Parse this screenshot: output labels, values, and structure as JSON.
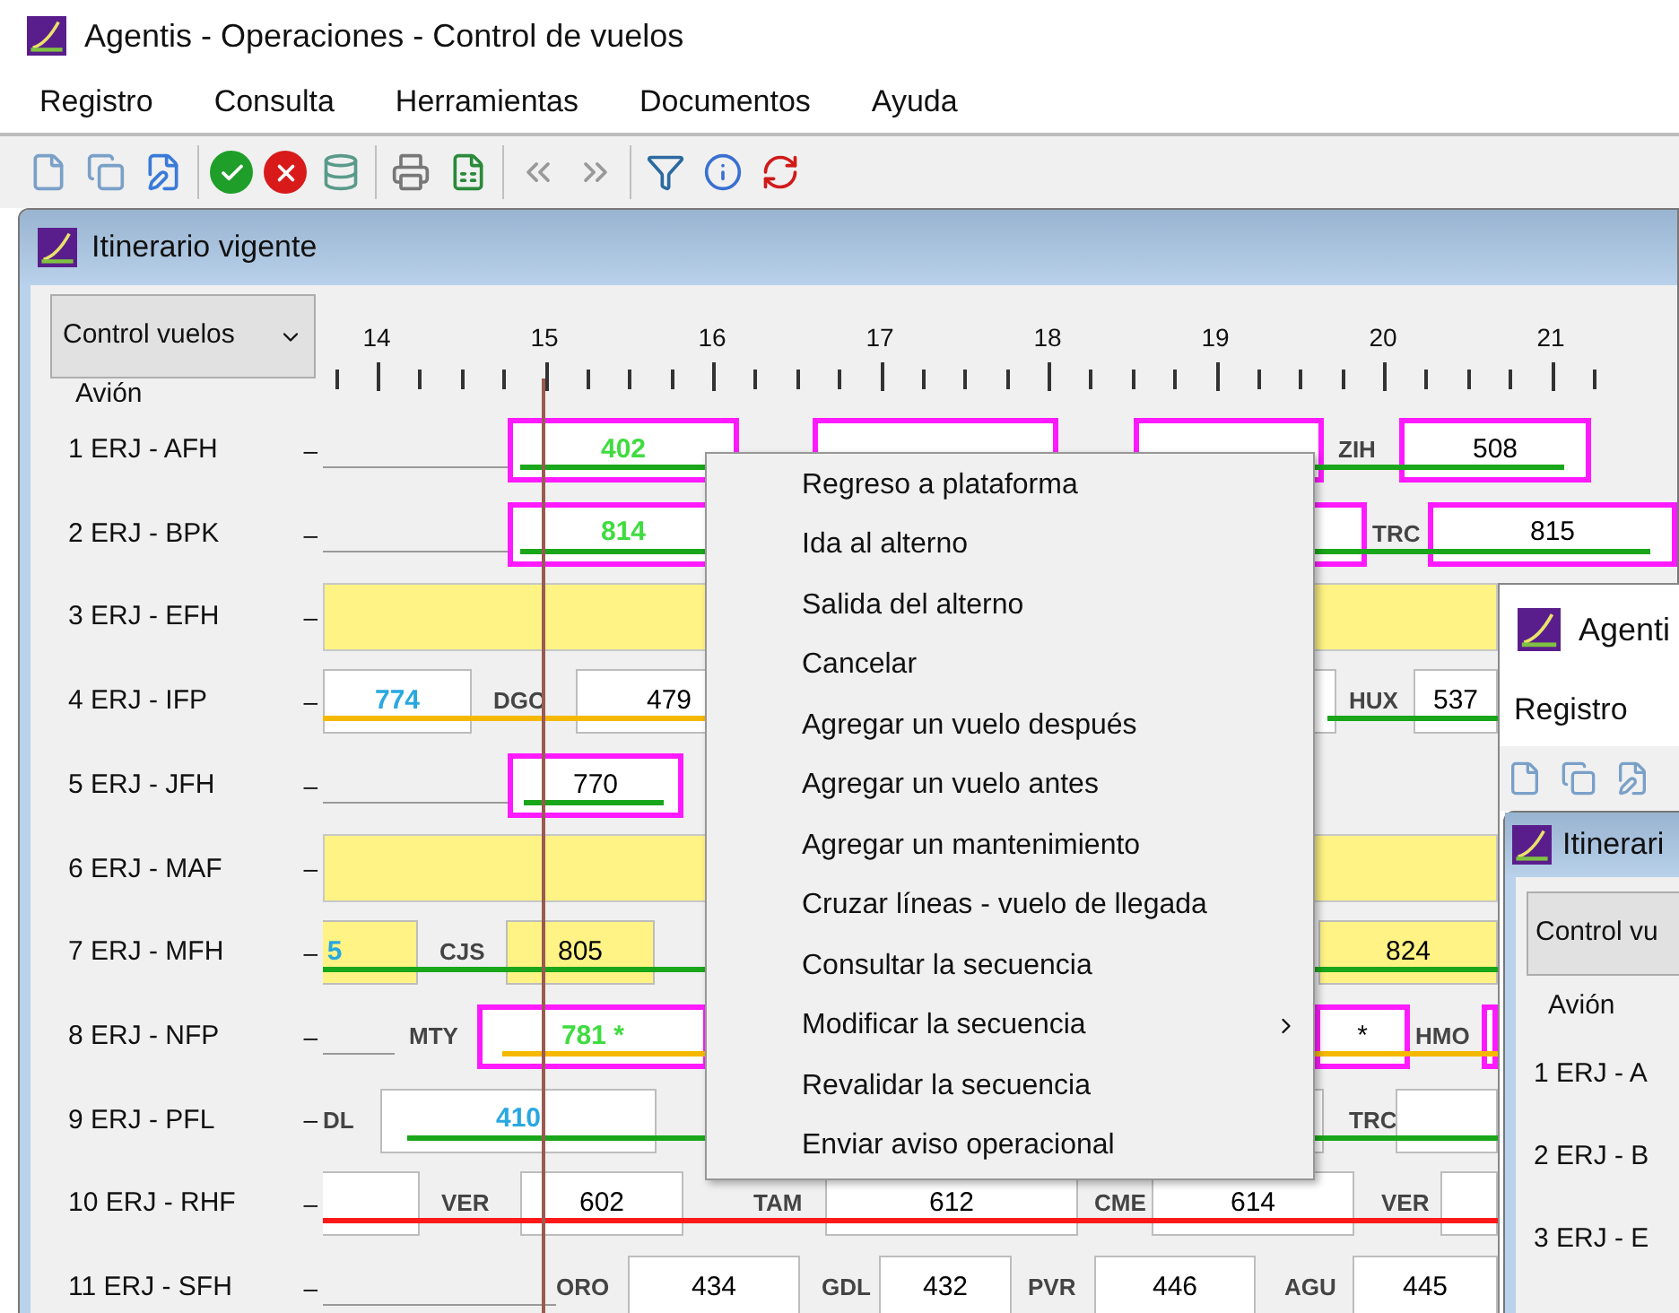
{
  "window": {
    "title": "Agentis - Operaciones - Control de vuelos"
  },
  "menu": [
    "Registro",
    "Consulta",
    "Herramientas",
    "Documentos",
    "Ayuda"
  ],
  "itinerary": {
    "title": "Itinerario vigente",
    "view": "Control vuelos",
    "aircraft_header": "Avión",
    "hours": [
      "14",
      "15",
      "16",
      "17",
      "18",
      "19",
      "20",
      "21"
    ],
    "rows": [
      {
        "aircraft": "1 ERJ - AFH",
        "prefix": "–",
        "tracks": [
          {
            "color": "#1aa61a"
          }
        ],
        "items": [
          {
            "kind": "line"
          },
          {
            "kind": "flight",
            "text": "402",
            "highlighted": true,
            "shaded": false,
            "color": "#3fdc3f"
          },
          {
            "kind": "flight",
            "highlighted": true,
            "shaded": false
          },
          {
            "kind": "flight",
            "highlighted": true,
            "shaded": false
          },
          {
            "kind": "station",
            "text": "ZIH"
          },
          {
            "kind": "flight",
            "text": "508",
            "highlighted": true,
            "shaded": false,
            "color": "#000000"
          }
        ]
      },
      {
        "aircraft": "2 ERJ - BPK",
        "prefix": "–",
        "tracks": [
          {
            "color": "#1aa61a"
          }
        ],
        "items": [
          {
            "kind": "line"
          },
          {
            "kind": "flight",
            "text": "814",
            "highlighted": true,
            "shaded": false,
            "color": "#3fdc3f"
          },
          {
            "kind": "flight",
            "highlighted": true,
            "shaded": false
          },
          {
            "kind": "station",
            "text": "TRC"
          },
          {
            "kind": "flight",
            "text": "815",
            "highlighted": true,
            "shaded": false,
            "color": "#000000"
          }
        ]
      },
      {
        "aircraft": "3 ERJ - EFH",
        "prefix": "–",
        "tracks": [],
        "items": [
          {
            "kind": "maintenance"
          }
        ]
      },
      {
        "aircraft": "4 ERJ - IFP",
        "prefix": "–",
        "tracks": [
          {
            "color": "#f5b800"
          },
          {
            "color": "#1aa61a"
          }
        ],
        "items": [
          {
            "kind": "flight",
            "text": "774",
            "highlighted": false,
            "shaded": false,
            "color": "#29a8e0"
          },
          {
            "kind": "station",
            "text": "DGO"
          },
          {
            "kind": "flight",
            "text": "479",
            "highlighted": false,
            "shaded": false,
            "color": "#000000"
          },
          {
            "kind": "flight",
            "highlighted": false,
            "shaded": false
          },
          {
            "kind": "station",
            "text": "HUX"
          },
          {
            "kind": "flight",
            "text": "537",
            "highlighted": false,
            "shaded": false,
            "color": "#000000"
          }
        ]
      },
      {
        "aircraft": "5 ERJ - JFH",
        "prefix": "–",
        "tracks": [
          {
            "color": "#1aa61a"
          }
        ],
        "items": [
          {
            "kind": "line"
          },
          {
            "kind": "flight",
            "text": "770",
            "highlighted": true,
            "shaded": false,
            "color": "#000000"
          }
        ]
      },
      {
        "aircraft": "6 ERJ - MAF",
        "prefix": "–",
        "tracks": [],
        "items": [
          {
            "kind": "maintenance"
          }
        ]
      },
      {
        "aircraft": "7 ERJ - MFH",
        "prefix": "–",
        "tracks": [
          {
            "color": "#1aa61a"
          }
        ],
        "items": [
          {
            "kind": "flight",
            "text": "5",
            "highlighted": false,
            "shaded": true,
            "color": "#29a8e0"
          },
          {
            "kind": "station",
            "text": "CJS"
          },
          {
            "kind": "flight",
            "text": "805",
            "highlighted": false,
            "shaded": true,
            "color": "#000000"
          },
          {
            "kind": "flight",
            "text": "824",
            "highlighted": false,
            "shaded": true,
            "color": "#000000"
          }
        ]
      },
      {
        "aircraft": "8 ERJ - NFP",
        "prefix": "–",
        "tracks": [
          {
            "color": "#f5b800"
          }
        ],
        "items": [
          {
            "kind": "line"
          },
          {
            "kind": "station",
            "text": "MTY"
          },
          {
            "kind": "flight",
            "text": "781 *",
            "highlighted": true,
            "shaded": false,
            "color": "#3fdc3f"
          },
          {
            "kind": "flight",
            "text": "*",
            "highlighted": true,
            "shaded": false,
            "color": "#000000"
          },
          {
            "kind": "station",
            "text": "HMO"
          },
          {
            "kind": "flight",
            "highlighted": true,
            "shaded": false
          }
        ]
      },
      {
        "aircraft": "9 ERJ - PFL",
        "prefix": "–",
        "tracks": [
          {
            "color": "#1aa61a"
          }
        ],
        "items": [
          {
            "kind": "station",
            "text": "DL"
          },
          {
            "kind": "flight",
            "text": "410",
            "highlighted": false,
            "shaded": false,
            "color": "#29a8e0"
          },
          {
            "kind": "flight",
            "highlighted": false,
            "shaded": false
          },
          {
            "kind": "station",
            "text": "TRC"
          },
          {
            "kind": "flight",
            "highlighted": false,
            "shaded": false
          }
        ]
      },
      {
        "aircraft": "10 ERJ - RHF",
        "prefix": "–",
        "tracks": [
          {
            "color": "#ff1a1a"
          }
        ],
        "items": [
          {
            "kind": "flight",
            "highlighted": false,
            "shaded": false
          },
          {
            "kind": "station",
            "text": "VER"
          },
          {
            "kind": "flight",
            "text": "602",
            "highlighted": false,
            "shaded": false,
            "color": "#000000"
          },
          {
            "kind": "station",
            "text": "TAM"
          },
          {
            "kind": "flight",
            "text": "612",
            "highlighted": false,
            "shaded": false,
            "color": "#000000"
          },
          {
            "kind": "station",
            "text": "CME"
          },
          {
            "kind": "flight",
            "text": "614",
            "highlighted": false,
            "shaded": false,
            "color": "#000000"
          },
          {
            "kind": "station",
            "text": "VER"
          },
          {
            "kind": "flight",
            "highlighted": false,
            "shaded": false
          }
        ]
      },
      {
        "aircraft": "11 ERJ - SFH",
        "prefix": "–",
        "tracks": [],
        "items": [
          {
            "kind": "line"
          },
          {
            "kind": "station",
            "text": "ORO"
          },
          {
            "kind": "flight",
            "text": "434",
            "highlighted": false,
            "shaded": false,
            "color": "#000000"
          },
          {
            "kind": "station",
            "text": "GDL"
          },
          {
            "kind": "flight",
            "text": "432",
            "highlighted": false,
            "shaded": false,
            "color": "#000000"
          },
          {
            "kind": "station",
            "text": "PVR"
          },
          {
            "kind": "flight",
            "text": "446",
            "highlighted": false,
            "shaded": false,
            "color": "#000000"
          },
          {
            "kind": "station",
            "text": "AGU"
          },
          {
            "kind": "flight",
            "text": "445",
            "highlighted": false,
            "shaded": false,
            "color": "#000000"
          }
        ]
      }
    ]
  },
  "context_menu": {
    "items": [
      {
        "label": "Regreso a plataforma",
        "submenu": false
      },
      {
        "label": "Ida al alterno",
        "submenu": false
      },
      {
        "label": "Salida del alterno",
        "submenu": false
      },
      {
        "label": "Cancelar",
        "submenu": false
      },
      {
        "label": "Agregar un vuelo después",
        "submenu": false
      },
      {
        "label": "Agregar un vuelo antes",
        "submenu": false
      },
      {
        "label": "Agregar un mantenimiento",
        "submenu": false
      },
      {
        "label": "Cruzar líneas - vuelo de llegada",
        "submenu": false
      },
      {
        "label": "Consultar la secuencia",
        "submenu": false
      },
      {
        "label": "Modificar la secuencia",
        "submenu": true
      },
      {
        "label": "Revalidar la secuencia",
        "submenu": false
      },
      {
        "label": "Enviar aviso operacional",
        "submenu": false
      }
    ]
  },
  "background_window": {
    "title": "Agenti",
    "menu": [
      "Registro"
    ],
    "child_title": "Itinerari",
    "view": "Control vu",
    "aircraft_header": "Avión",
    "rows": [
      "1 ERJ - A",
      "2 ERJ - B",
      "3 ERJ - E"
    ]
  }
}
